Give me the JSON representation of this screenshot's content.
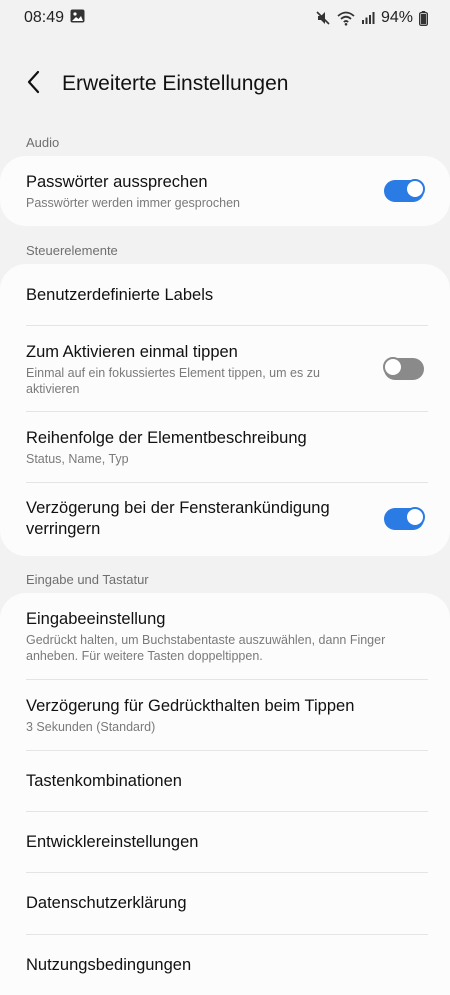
{
  "status_bar": {
    "time": "08:49",
    "battery": "94%",
    "icons": [
      "gallery-icon",
      "mute-icon",
      "wifi-icon",
      "signal-icon",
      "battery-icon"
    ]
  },
  "header": {
    "title": "Erweiterte Einstellungen",
    "back_icon": "back-arrow-icon"
  },
  "sections": {
    "audio": {
      "label": "Audio",
      "items": [
        {
          "title": "Passwörter aussprechen",
          "subtitle": "Passwörter werden immer gesprochen",
          "toggle": true
        }
      ]
    },
    "controls": {
      "label": "Steuerelemente",
      "items": [
        {
          "title": "Benutzerdefinierte Labels"
        },
        {
          "title": "Zum Aktivieren einmal tippen",
          "subtitle": "Einmal auf ein fokussiertes Element tippen, um es zu aktivieren",
          "toggle": false
        },
        {
          "title": "Reihenfolge der Elementbeschreibung",
          "subtitle": "Status, Name, Typ"
        },
        {
          "title": "Verzögerung bei der Fensterankündigung verringern",
          "toggle": true
        }
      ]
    },
    "input": {
      "label": "Eingabe und Tastatur",
      "items": [
        {
          "title": "Eingabeeinstellung",
          "subtitle": "Gedrückt halten, um Buchstabentaste auszuwählen, dann Finger anheben. Für weitere Tasten doppeltippen."
        },
        {
          "title": "Verzögerung für Gedrückthalten beim Tippen",
          "subtitle": "3 Sekunden (Standard)"
        },
        {
          "title": "Tastenkombinationen"
        },
        {
          "title": "Entwicklereinstellungen"
        },
        {
          "title": "Datenschutzerklärung"
        },
        {
          "title": "Nutzungsbedingungen"
        }
      ]
    }
  },
  "colors": {
    "accent": "#2a7be4",
    "background": "#f2f2f2",
    "card": "#fcfcfc"
  }
}
